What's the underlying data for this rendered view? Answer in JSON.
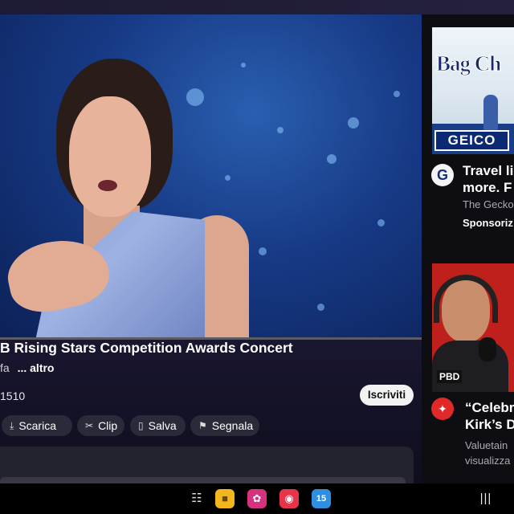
{
  "player": {
    "title": "B Rising Stars Competition Awards Concert",
    "channel": "fa",
    "more_label": "... altro",
    "count": "1510",
    "subscribe_label": "Iscriviti",
    "actions": [
      {
        "label": "Scarica",
        "icon": "download-icon"
      },
      {
        "label": "Clip",
        "icon": "scissors-icon"
      },
      {
        "label": "Salva",
        "icon": "bookmark-icon"
      },
      {
        "label": "Segnala",
        "icon": "flag-icon"
      }
    ]
  },
  "sidebar": {
    "ad": {
      "thumb_text": "Bag Ch",
      "logo_text": "GEICO",
      "icon_letter": "G",
      "title": "Travel li\nmore. F",
      "channel": "The Gecko",
      "sponsored": "Sponsoriz"
    },
    "video2": {
      "thumb_badge": "PBD",
      "title": "“Celebr\nKirk’s D",
      "channel": "Valuetain\nvisualizza"
    }
  },
  "taskbar": {
    "calendar_day": "15"
  },
  "colors": {
    "background": "#0b0b12",
    "chip": "#2b2a3a",
    "subscribe": "#f2f2f2",
    "geico_blue": "#0c2a73"
  }
}
